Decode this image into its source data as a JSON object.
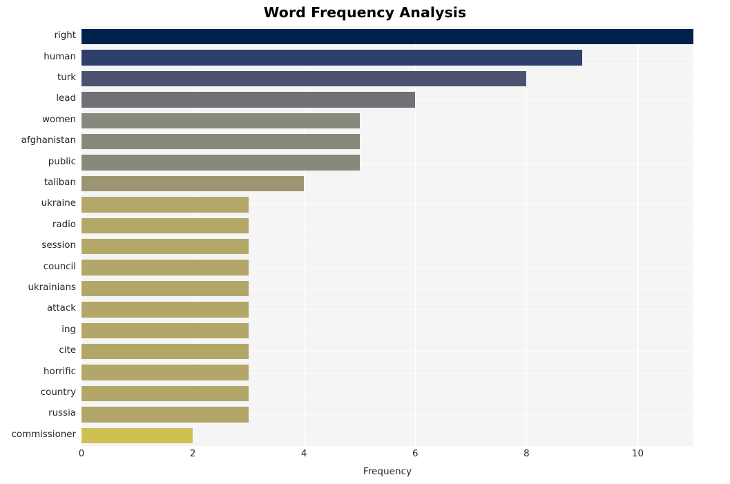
{
  "chart_data": {
    "type": "bar",
    "orientation": "horizontal",
    "title": "Word Frequency Analysis",
    "xlabel": "Frequency",
    "ylabel": "",
    "xlim": [
      0,
      11.0
    ],
    "ylim_categories": 20,
    "grid": true,
    "grid_axis": "both",
    "legend": null,
    "categories": [
      "right",
      "human",
      "turk",
      "lead",
      "women",
      "afghanistan",
      "public",
      "taliban",
      "ukraine",
      "radio",
      "session",
      "council",
      "ukrainians",
      "attack",
      "ing",
      "cite",
      "horrific",
      "country",
      "russia",
      "commissioner"
    ],
    "values": [
      11,
      9,
      8,
      6,
      5,
      5,
      5,
      4,
      3,
      3,
      3,
      3,
      3,
      3,
      3,
      3,
      3,
      3,
      3,
      2
    ],
    "xticks": [
      0,
      2,
      4,
      6,
      8,
      10
    ],
    "xtick_labels": [
      "0",
      "2",
      "4",
      "6",
      "8",
      "10"
    ],
    "bar_colors": [
      "#00204d",
      "#2e3f6c",
      "#4a5270",
      "#6f7175",
      "#858a7c",
      "#868a7b",
      "#868a7b",
      "#9c9573",
      "#b3a869",
      "#b3a868",
      "#b3a868",
      "#b2a768",
      "#b2a768",
      "#b2a768",
      "#b2a768",
      "#b2a768",
      "#b2a768",
      "#b2a768",
      "#b1a667",
      "#cfc054"
    ],
    "colormap": "cividis",
    "style": "whitegrid",
    "plot_background": "#f5f5f5",
    "grid_color": "#ffffff",
    "text_color": "#262626"
  }
}
